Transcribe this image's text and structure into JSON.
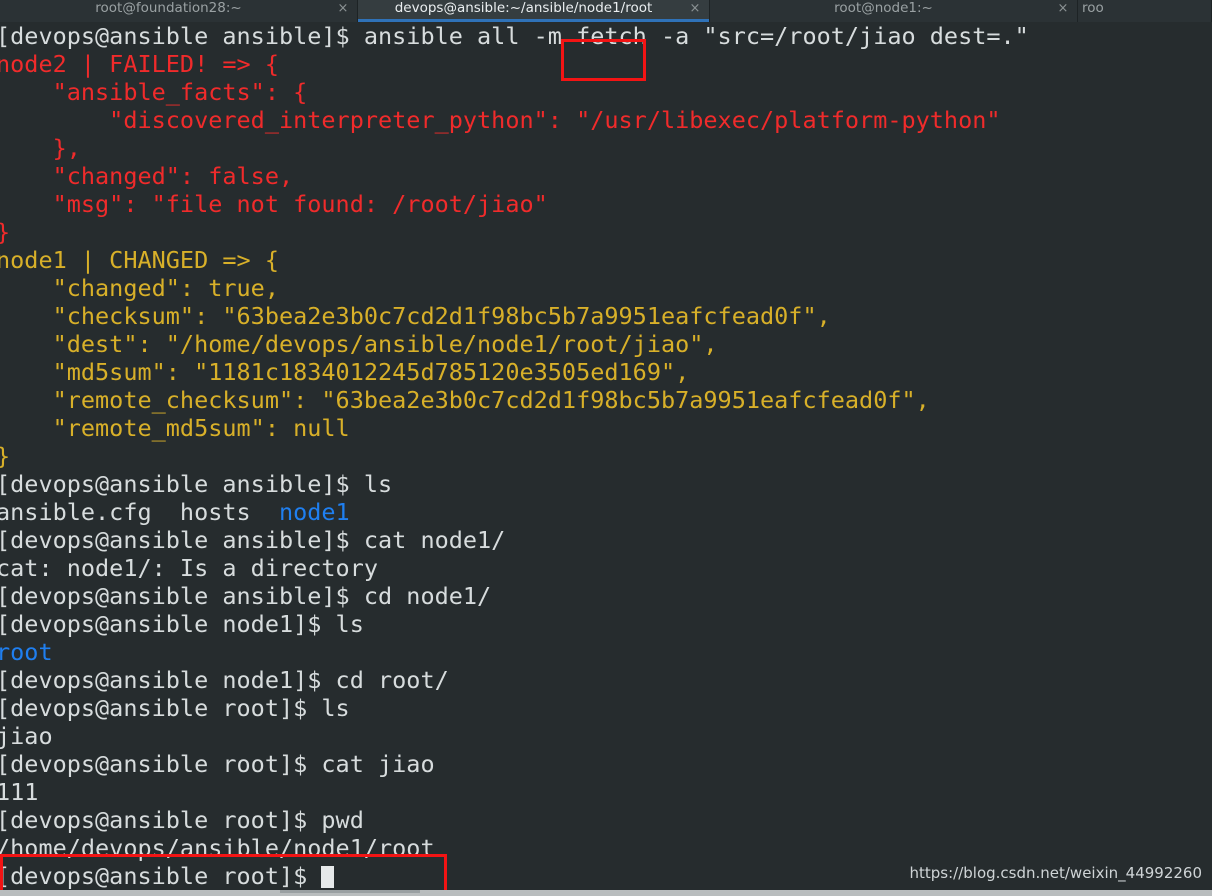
{
  "window": {
    "tabs": [
      {
        "label": "root@foundation28:~",
        "active": false,
        "close_icon": "×"
      },
      {
        "label": "devops@ansible:~/ansible/node1/root",
        "active": true,
        "close_icon": "×"
      },
      {
        "label": "root@node1:~",
        "active": false,
        "close_icon": "×"
      },
      {
        "label": "roo",
        "active": false,
        "close_icon": ""
      }
    ]
  },
  "colors": {
    "background": "#262c2e",
    "tabbar": "#2b3235",
    "tab_active": "#353d40",
    "tab_underline": "#2f72b8",
    "text": "#d7dcdd",
    "failed": "#f02b2b",
    "changed": "#d8b029",
    "directory": "#1f7ff0",
    "annotation": "#f31414"
  },
  "terminal": {
    "lines": [
      {
        "text": "[devops@ansible ansible]$ ansible all -m fetch -a \"src=/root/jiao dest=.\"",
        "color": "white"
      },
      {
        "text": "node2 | FAILED! => {",
        "color": "red"
      },
      {
        "text": "    \"ansible_facts\": {",
        "color": "red"
      },
      {
        "text": "        \"discovered_interpreter_python\": \"/usr/libexec/platform-python\"",
        "color": "red"
      },
      {
        "text": "    },",
        "color": "red"
      },
      {
        "text": "    \"changed\": false,",
        "color": "red"
      },
      {
        "text": "    \"msg\": \"file not found: /root/jiao\"",
        "color": "red"
      },
      {
        "text": "}",
        "color": "red"
      },
      {
        "text": "node1 | CHANGED => {",
        "color": "yellow"
      },
      {
        "text": "    \"changed\": true,",
        "color": "yellow"
      },
      {
        "text": "    \"checksum\": \"63bea2e3b0c7cd2d1f98bc5b7a9951eafcfead0f\",",
        "color": "yellow"
      },
      {
        "text": "    \"dest\": \"/home/devops/ansible/node1/root/jiao\",",
        "color": "yellow"
      },
      {
        "text": "    \"md5sum\": \"1181c1834012245d785120e3505ed169\",",
        "color": "yellow"
      },
      {
        "text": "    \"remote_checksum\": \"63bea2e3b0c7cd2d1f98bc5b7a9951eafcfead0f\",",
        "color": "yellow"
      },
      {
        "text": "    \"remote_md5sum\": null",
        "color": "yellow"
      },
      {
        "text": "}",
        "color": "yellow"
      },
      {
        "text": "[devops@ansible ansible]$ ls",
        "color": "white"
      },
      {
        "segments": [
          {
            "text": "ansible.cfg  hosts  ",
            "color": "white"
          },
          {
            "text": "node1",
            "color": "blue"
          }
        ]
      },
      {
        "text": "[devops@ansible ansible]$ cat node1/",
        "color": "white"
      },
      {
        "text": "cat: node1/: Is a directory",
        "color": "white"
      },
      {
        "text": "[devops@ansible ansible]$ cd node1/",
        "color": "white"
      },
      {
        "text": "[devops@ansible node1]$ ls",
        "color": "white"
      },
      {
        "text": "root",
        "color": "blue"
      },
      {
        "text": "[devops@ansible node1]$ cd root/",
        "color": "white"
      },
      {
        "text": "[devops@ansible root]$ ls",
        "color": "white"
      },
      {
        "text": "jiao",
        "color": "white"
      },
      {
        "text": "[devops@ansible root]$ cat jiao",
        "color": "white"
      },
      {
        "text": "111",
        "color": "white"
      },
      {
        "text": "[devops@ansible root]$ pwd",
        "color": "white"
      },
      {
        "text": "/home/devops/ansible/node1/root",
        "color": "white"
      },
      {
        "text": "[devops@ansible root]$ ",
        "color": "white",
        "cursor": true
      }
    ]
  },
  "annotations": [
    {
      "name": "fetch-module-highlight",
      "target": "fetch"
    },
    {
      "name": "pwd-output-highlight",
      "target": "/home/devops/ansible/node1/root"
    }
  ],
  "watermark": {
    "text": "https://blog.csdn.net/weixin_44992260"
  }
}
